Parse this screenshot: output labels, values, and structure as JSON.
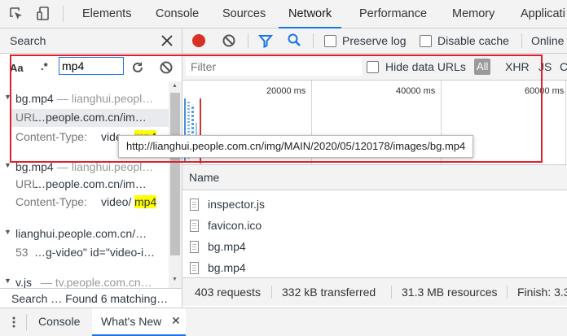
{
  "top_tabs": [
    "Elements",
    "Console",
    "Sources",
    "Network",
    "Performance",
    "Memory",
    "Applicati"
  ],
  "active_tab": "Network",
  "search_panel": {
    "title": "Search",
    "case_toggle": "Aa",
    "regex_toggle": ".*",
    "query": "mp4",
    "results": [
      {
        "file": "bg.mp4",
        "origin": "— lianghui.peopl…",
        "lines": [
          {
            "key": "URL",
            "pre": "…people.com.cn/im…",
            "match": "",
            "post": ""
          },
          {
            "key": "Content-Type:",
            "pre": "vide",
            "match": "mp4",
            "post": ""
          }
        ]
      },
      {
        "file": "bg.mp4",
        "origin": "— lianghui.peopl…",
        "lines": [
          {
            "key": "URL",
            "pre": "…people.com.cn/im…",
            "match": "",
            "post": ""
          },
          {
            "key": "Content-Type:",
            "pre": "video/",
            "match": "mp4",
            "post": ""
          }
        ]
      },
      {
        "file": "lianghui.people.com.cn/…",
        "origin": "",
        "lines": [
          {
            "key": "53",
            "pre": "…g-video\" id=\"video-i…",
            "match": "",
            "post": ""
          }
        ]
      },
      {
        "file": "v.js",
        "origin": "— tv.people.com.cn…",
        "lines": []
      }
    ],
    "status": "Search …  Found 6 matching…"
  },
  "network": {
    "preserve_log": "Preserve log",
    "disable_cache": "Disable cache",
    "online": "Online",
    "filter_placeholder": "Filter",
    "hide_data_urls": "Hide data URLs",
    "filter_types": [
      "All",
      "XHR",
      "JS",
      "C"
    ],
    "timeline_labels": [
      "20000 ms",
      "40000 ms",
      "60000 ms"
    ],
    "column_name": "Name",
    "requests": [
      "inspector.js",
      "favicon.ico",
      "bg.mp4",
      "bg.mp4"
    ],
    "status": {
      "requests": "403 requests",
      "transferred": "332 kB transferred",
      "resources": "31.3 MB resources",
      "finish": "Finish: 3.3"
    }
  },
  "tooltip": "http://lianghui.people.com.cn/img/MAIN/2020/05/120178/images/bg.mp4",
  "drawer_tabs": {
    "console": "Console",
    "whats_new": "What's New"
  },
  "colors": {
    "accent": "#1a73e8",
    "record_red": "#d93025",
    "highlight": "#ffff00",
    "annotation": "#e0202a"
  }
}
